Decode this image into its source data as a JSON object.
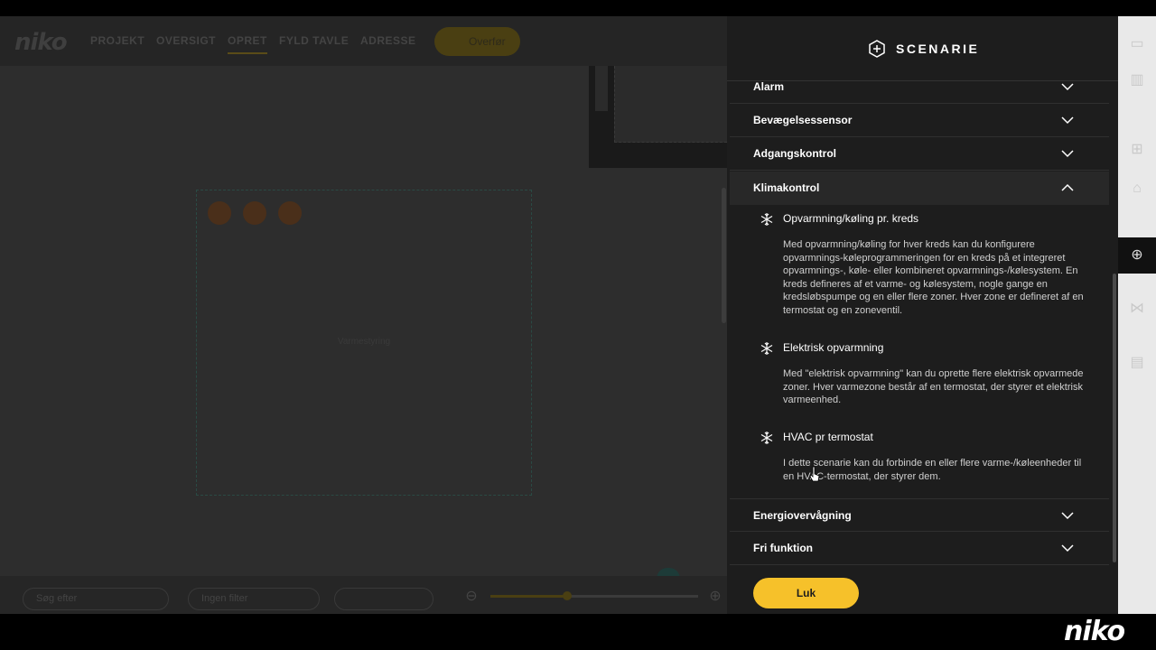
{
  "brand": {
    "logo_text": "niko",
    "watermark_text": "niko"
  },
  "topbar": {
    "nav": [
      "PROJEKT",
      "OVERSIGT",
      "OPRET",
      "FYLD TAVLE",
      "ADRESSE"
    ],
    "active_nav": "OPRET",
    "transfer_label": "Overfør"
  },
  "canvas": {
    "floor_label": "Varmestyring"
  },
  "bottombar": {
    "search_placeholder": "Søg efter",
    "filter_label": "Ingen filter"
  },
  "panel": {
    "title": "SCENARIE",
    "sections": [
      {
        "label": "Alarm",
        "open": false
      },
      {
        "label": "Bevægelsessensor",
        "open": false
      },
      {
        "label": "Adgangskontrol",
        "open": false
      },
      {
        "label": "Klimakontrol",
        "open": true
      },
      {
        "label": "Energiovervågning",
        "open": false
      },
      {
        "label": "Fri funktion",
        "open": false
      }
    ],
    "klimakontrol_options": [
      {
        "title": "Opvarmning/køling pr. kreds",
        "description": "Med opvarmning/køling for hver kreds kan du konfigurere opvarmnings-køleprogrammeringen for en kreds på et integreret opvarmnings-, køle- eller kombineret opvarmnings-/kølesystem. En kreds defineres af et varme- og kølesystem, nogle gange en kredsløbspumpe og en eller flere zoner. Hver zone er defineret af en termostat og en zoneventil."
      },
      {
        "title": "Elektrisk opvarmning",
        "description": "Med \"elektrisk opvarmning\" kan du oprette flere elektrisk opvarmede zoner. Hver varmezone består af en termostat, der styrer et elektrisk varmeenhed."
      },
      {
        "title": "HVAC pr termostat",
        "description": "I dette scenarie kan du forbinde en eller flere varme-/køleenheder til en HVAC-termostat, der styrer dem."
      }
    ],
    "close_label": "Luk"
  },
  "colors": {
    "accent": "#f6c12a",
    "panel_bg": "#1d1d1d",
    "dim_bg": "#2a2a2a"
  }
}
